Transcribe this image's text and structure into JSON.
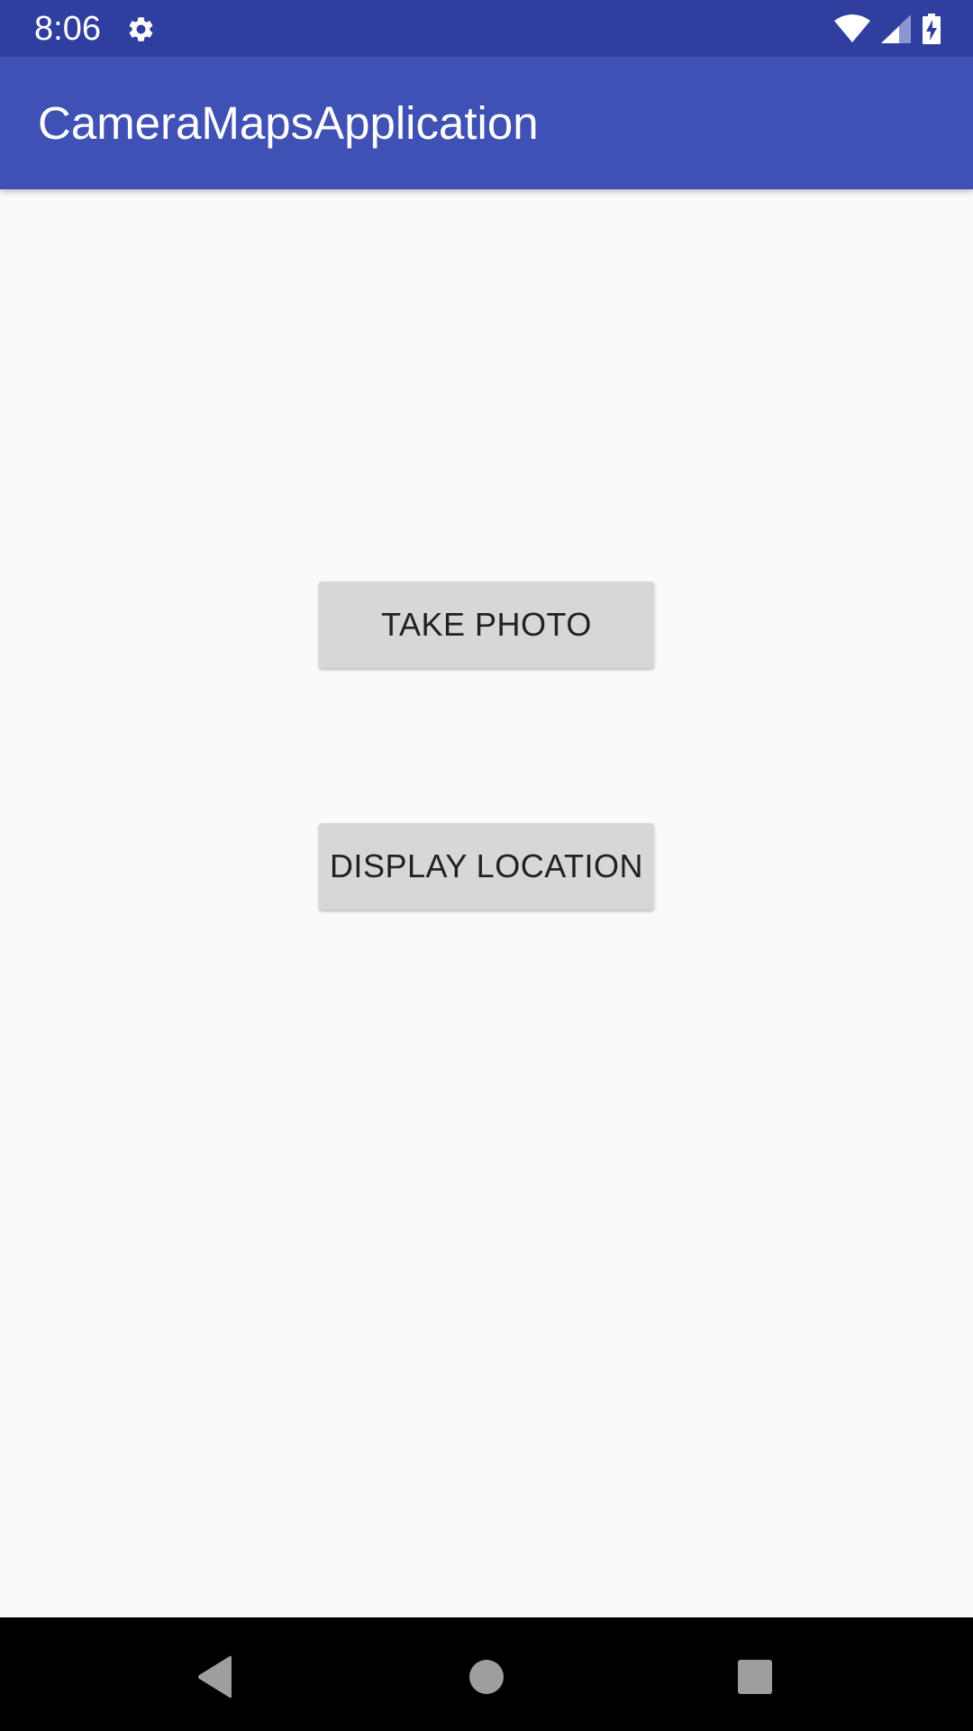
{
  "status_bar": {
    "time": "8:06",
    "icons": [
      "gear-icon",
      "wifi-icon",
      "signal-icon",
      "battery-charging-icon"
    ],
    "background": "#303f9f"
  },
  "app_bar": {
    "title": "CameraMapsApplication",
    "background": "#3f51b5"
  },
  "main": {
    "take_photo_label": "TAKE PHOTO",
    "display_location_label": "DISPLAY LOCATION",
    "button_color": "#d6d7d7"
  },
  "nav_bar": {
    "icons": [
      "back-icon",
      "home-icon",
      "recents-icon"
    ]
  }
}
